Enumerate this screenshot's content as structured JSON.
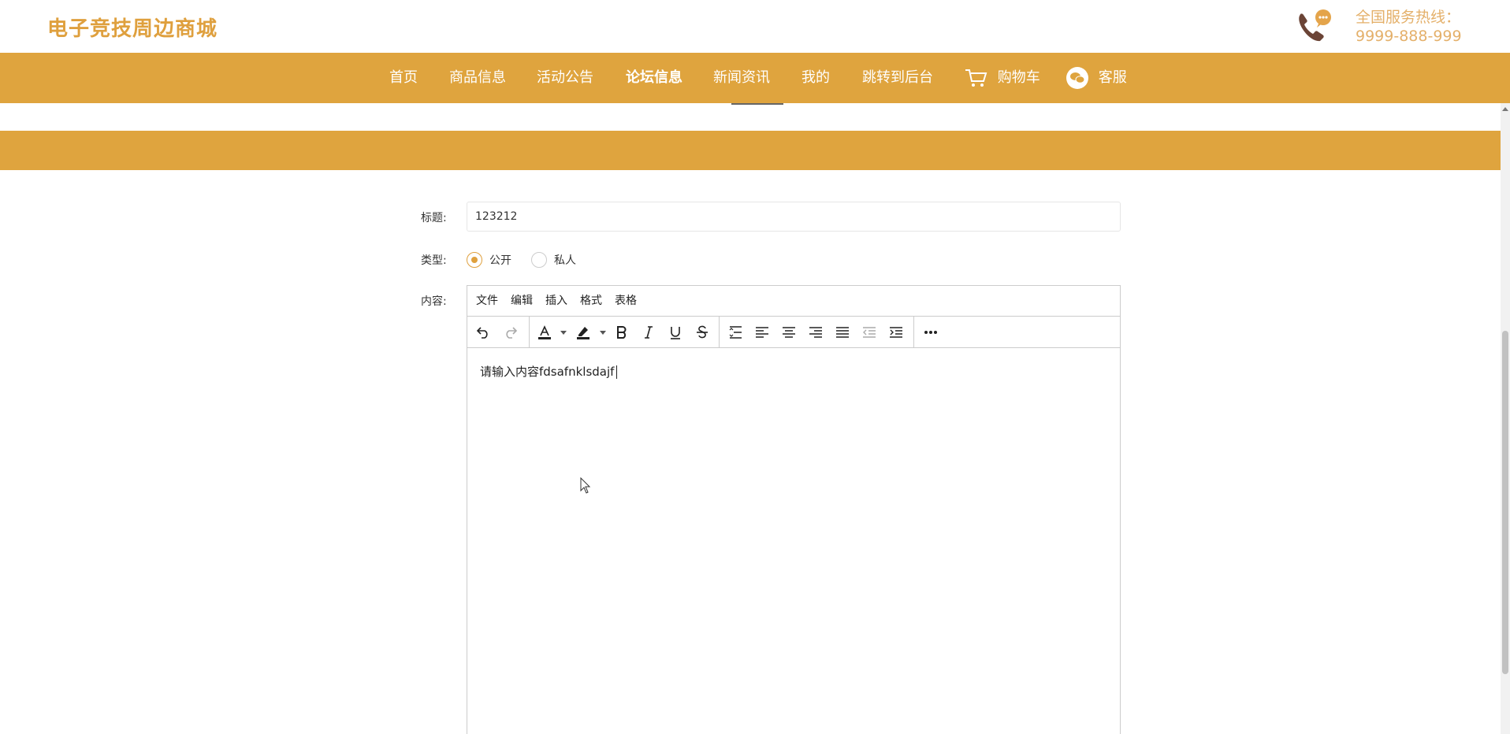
{
  "header": {
    "brand": "电子竞技周边商城",
    "hotline_label": "全国服务热线：",
    "hotline_number": "9999-888-999",
    "hotline_icon": "phone-chat-icon"
  },
  "nav": {
    "items": [
      {
        "label": "首页"
      },
      {
        "label": "商品信息"
      },
      {
        "label": "活动公告"
      },
      {
        "label": "论坛信息",
        "active": true
      },
      {
        "label": "新闻资讯"
      },
      {
        "label": "我的"
      },
      {
        "label": "跳转到后台"
      },
      {
        "label": "购物车",
        "icon": "cart-icon"
      },
      {
        "label": "客服",
        "icon": "wechat-icon"
      }
    ]
  },
  "form": {
    "title_label": "标题:",
    "title_value": "123212",
    "type_label": "类型:",
    "type_options": [
      {
        "label": "公开",
        "checked": true
      },
      {
        "label": "私人",
        "checked": false
      }
    ],
    "content_label": "内容:",
    "editor": {
      "menu": [
        "文件",
        "编辑",
        "插入",
        "格式",
        "表格"
      ],
      "toolbar": [
        "undo-icon",
        "redo-icon",
        "font-color-icon",
        "highlight-icon",
        "bold-icon",
        "italic-icon",
        "underline-icon",
        "strikethrough-icon",
        "line-height-icon",
        "align-left-icon",
        "align-center-icon",
        "align-right-icon",
        "align-justify-icon",
        "outdent-icon",
        "indent-icon",
        "more-icon"
      ],
      "content": "请输入内容fdsafnklsdajf"
    }
  },
  "colors": {
    "accent": "#dfa43e",
    "brand_text": "#dfa03e",
    "hotline_text": "#e4b06a"
  }
}
